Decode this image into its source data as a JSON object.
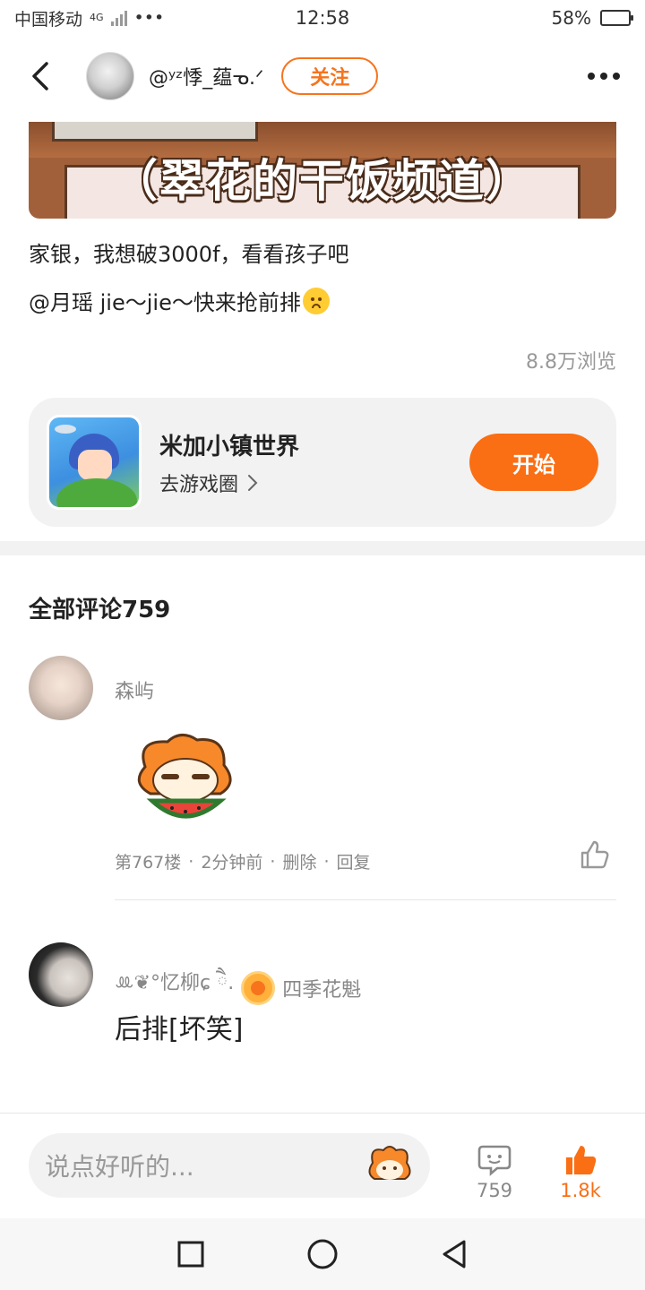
{
  "status_bar": {
    "carrier": "中国移动",
    "network": "4G",
    "time": "12:58",
    "battery_percent": "58%",
    "battery_level": 0.58
  },
  "header": {
    "author_name": "@ʸᶻ悸_蕴ᓀ.ᐟ",
    "follow_label": "关注"
  },
  "banner": {
    "text": "（翠花的干饭频道）"
  },
  "post": {
    "line1": "家银，我想破3000f，看看孩子吧",
    "line2": "@月瑶 jie～jie～快来抢前排",
    "views": "8.8万浏览"
  },
  "game_card": {
    "title": "米加小镇世界",
    "subtitle": "去游戏圈",
    "start_label": "开始"
  },
  "comments": {
    "title": "全部评论759",
    "items": [
      {
        "name": "森屿",
        "floor": "第767楼",
        "time": "2分钟前",
        "delete": "删除",
        "reply": "回复"
      },
      {
        "name": "ꔛ❦°忆柳ɕ ཻ.",
        "badge": "四季花魁",
        "text": "后排[坏笑]"
      }
    ]
  },
  "bottom_bar": {
    "placeholder": "说点好听的...",
    "comment_count": "759",
    "like_count": "1.8k"
  },
  "colors": {
    "accent": "#fa6e14",
    "follow": "#f7741d",
    "muted": "#888888"
  },
  "icons": [
    "back-arrow-icon",
    "more-icon",
    "chevron-right-icon",
    "thumb-up-icon",
    "comment-bubble-icon",
    "square-icon",
    "circle-icon",
    "triangle-back-icon"
  ]
}
